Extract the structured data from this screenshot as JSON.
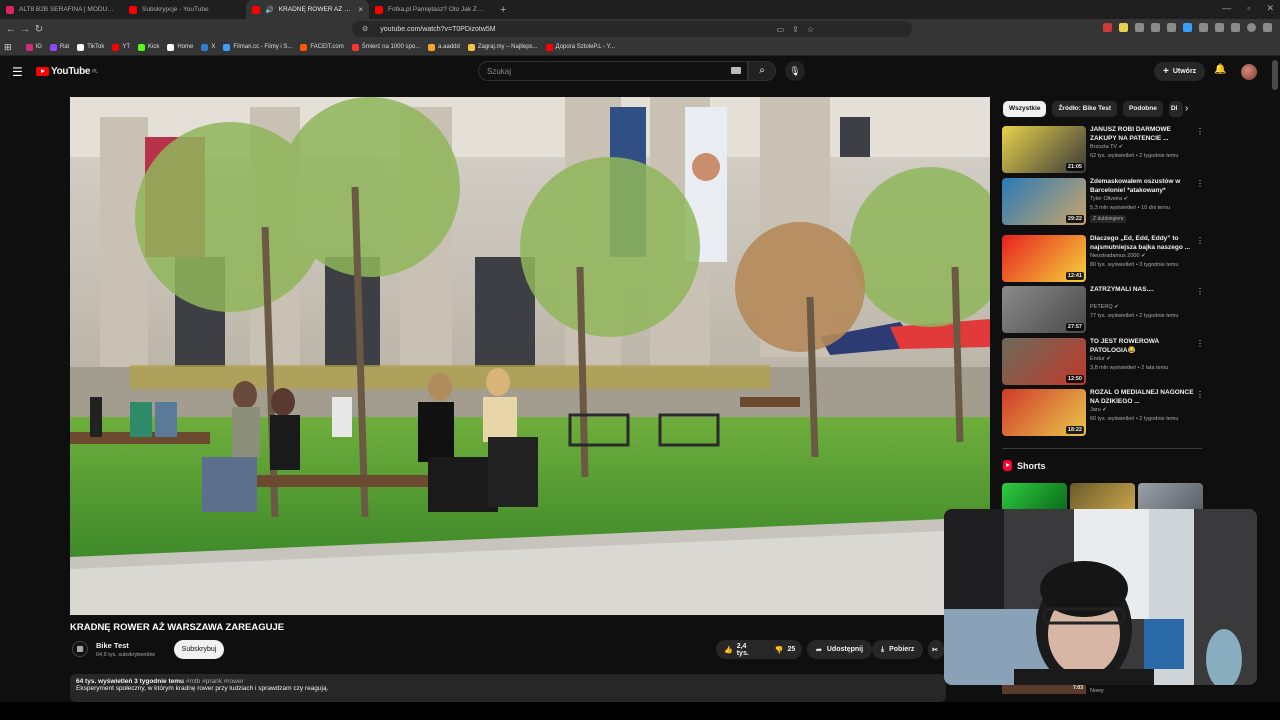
{
  "browser": {
    "tabs": [
      {
        "title": "ALT8 B2B SERAFINA | MODUŁ AR",
        "favicon_color": "#e0245e"
      },
      {
        "title": "Subskrypcje - YouTube",
        "favicon_color": "#ff0000"
      },
      {
        "title": "KRADNĘ ROWER AŻ WARSZA",
        "favicon_color": "#ff0000",
        "active": true
      },
      {
        "title": "Fotka.pl Pamiętasz? Oto Jak Zarobił",
        "favicon_color": "#ff0000"
      }
    ],
    "url": "youtube.com/watch?v=T0PDizotw5M",
    "bookmarks": [
      {
        "label": "IG",
        "color": "#d62976"
      },
      {
        "label": "Rat",
        "color": "#9146ff"
      },
      {
        "label": "TikTok",
        "color": "#ffffff"
      },
      {
        "label": "YT",
        "color": "#ff0000"
      },
      {
        "label": "Kick",
        "color": "#53fc18"
      },
      {
        "label": "Home",
        "color": "#ffffff"
      },
      {
        "label": "X",
        "color": "#2d7dd2"
      },
      {
        "label": "Filman.cc - Filmy i S...",
        "color": "#3aa0ff"
      },
      {
        "label": "FACEIT.com",
        "color": "#ff5500"
      },
      {
        "label": "Śmierć na 1000 spo...",
        "color": "#ff3333"
      },
      {
        "label": "a.aaddd",
        "color": "#f6a623"
      },
      {
        "label": "Zagraj.my – Najlleps...",
        "color": "#f5c542"
      },
      {
        "label": "Дорога SztoleP.L - Y...",
        "color": "#ff0000"
      }
    ]
  },
  "youtube": {
    "logo_text": "YouTube",
    "logo_region": "PL",
    "search_placeholder": "Szukaj",
    "create_label": "Utwórz",
    "video": {
      "title": "KRADNĘ ROWER AŻ WARSZAWA ZAREAGUJE",
      "channel": "Bike Test",
      "subscribers": "64,9 tys. subskrybentów",
      "subscribe_label": "Subskrybuj",
      "likes": "2,4 tys.",
      "dislikes": "25",
      "share_label": "Udostępnij",
      "download_label": "Pobierz",
      "views_date": "64 tys. wyświetleń  3 tygodnie temu",
      "hashtags": "#mtb #prank #rower",
      "description": "Eksperyment społeczny, w którym kradnę rower przy ludziach i sprawdzam czy reagują."
    },
    "chips": [
      "Wszystkie",
      "Źródło: Bike Test",
      "Podobne",
      "Dl"
    ],
    "recommendations": [
      {
        "title": "JANUSZ ROBI DARMOWE ZAKUPY NA PATENCIE ...",
        "channel": "Brzozta TV",
        "meta": "62 tys. wyświetleń • 2 tygodnie temu",
        "duration": "21:05",
        "thumb_colors": [
          "#e8d24a",
          "#3a3a3a"
        ]
      },
      {
        "title": "Zdemaskowałem oszustów w Barcelonie! *atakowany*",
        "channel": "Tyler Oliveira",
        "meta": "5,3 mln wyświetleń • 10 dni temu",
        "duration": "29:22",
        "badge": "Z dubbingiem",
        "thumb_colors": [
          "#2a7ab8",
          "#c9a56a"
        ]
      },
      {
        "title": "Dlaczego „Ed, Edd, Eddy” to najsmutniejsza bajka naszego ...",
        "channel": "Neostradamus 2000",
        "meta": "80 tys. wyświetleń • 3 tygodnie temu",
        "duration": "12:41",
        "thumb_colors": [
          "#e82020",
          "#f4d43a"
        ]
      },
      {
        "title": "ZATRZYMALI NAS....",
        "channel": "PETERQ",
        "meta": "77 tys. wyświetleń • 2 tygodnie temu",
        "duration": "27:57",
        "thumb_colors": [
          "#8a8a8a",
          "#4a4a4a"
        ]
      },
      {
        "title": "TO JEST ROWEROWA PATOLOGIA😂",
        "channel": "Endur",
        "meta": "3,8 mln wyświetleń • 2 lata temu",
        "duration": "12:50",
        "thumb_colors": [
          "#6b6b5a",
          "#c0392b"
        ]
      },
      {
        "title": "RÓŻAL O MEDIALNEJ NAGONCE NA DZIKIEGO ...",
        "channel": "Jaru",
        "meta": "60 tys. wyświetleń • 2 tygodnie temu",
        "duration": "18:22",
        "thumb_colors": [
          "#d13a2a",
          "#e8c84a"
        ]
      }
    ],
    "shorts_title": "Shorts",
    "shorts_duration": "7:03",
    "shorts_new_label": "Nowy"
  }
}
